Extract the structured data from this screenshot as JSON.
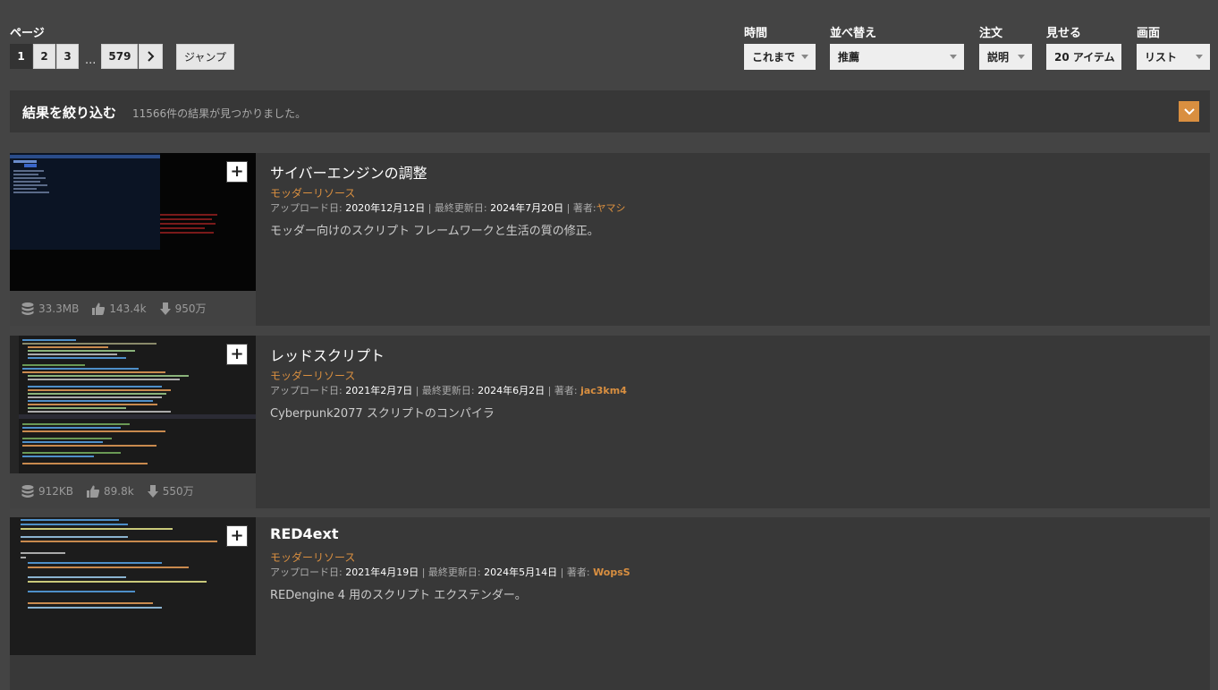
{
  "toolbar": {
    "page_label": "ページ",
    "pages": [
      "1",
      "2",
      "3"
    ],
    "ellipsis": "...",
    "last_page": "579",
    "next_arrow": "›",
    "jump_label": "ジャンプ",
    "time_label": "時間",
    "time_value": "これまで",
    "sort_label": "並べ替え",
    "sort_value": "推薦",
    "order_label": "注文",
    "order_value": "説明",
    "show_label": "見せる",
    "show_value": "20 アイテム",
    "view_label": "画面",
    "view_value": "リスト"
  },
  "filter": {
    "title": "結果を絞り込む",
    "count_text": "11566件の結果が見つかりました。"
  },
  "labels": {
    "upload": "アップロード日:",
    "updated": "最終更新日:",
    "author": "著者:",
    "add": "+"
  },
  "mods": [
    {
      "title": "サイバーエンジンの調整",
      "category": "モッダーリソース",
      "upload_date": "2020年12月12日",
      "updated_date": "2024年7月20日",
      "author": "ヤマシ",
      "description": "モッダー向けのスクリプト フレームワークと生活の質の修正。",
      "size": "33.3MB",
      "endorsements": "143.4k",
      "downloads": "950万"
    },
    {
      "title": "レッドスクリプト",
      "category": "モッダーリソース",
      "upload_date": "2021年2月7日",
      "updated_date": "2024年6月2日",
      "author": "jac3km4",
      "description": "Cyberpunk2077 スクリプトのコンパイラ",
      "size": "912KB",
      "endorsements": "89.8k",
      "downloads": "550万"
    },
    {
      "title": "RED4ext",
      "category": "モッダーリソース",
      "upload_date": "2021年4月19日",
      "updated_date": "2024年5月14日",
      "author": "WopsS",
      "description": "REDengine 4 用のスクリプト エクステンダー。"
    }
  ],
  "colors": {
    "accent": "#d98f40",
    "background": "#444444",
    "card": "#383838"
  }
}
